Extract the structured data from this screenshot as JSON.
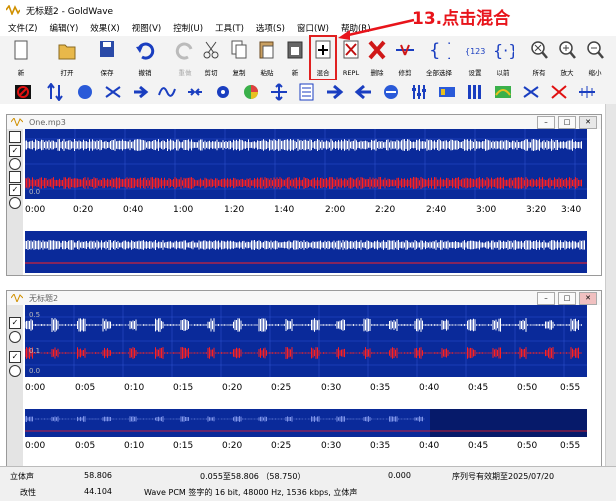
{
  "window": {
    "title": "无标题2 - GoldWave"
  },
  "menu": [
    "文件(Z)",
    "编辑(Y)",
    "效果(X)",
    "视图(V)",
    "控制(U)",
    "工具(T)",
    "选项(S)",
    "窗口(W)",
    "帮助(R)"
  ],
  "toolbar": {
    "new": "新",
    "open": "打开",
    "save": "保存",
    "undo": "撤销",
    "redo": "重做",
    "cut": "剪切",
    "copy": "复制",
    "paste": "粘贴",
    "paste_new": "新",
    "mix": "混合",
    "replace": "REPL",
    "delete": "删除",
    "trim": "修剪",
    "select_all": "全部选择",
    "set": "设置",
    "previous": "以前",
    "all": "所有",
    "zoom_in": "放大",
    "zoom_out": "缩小"
  },
  "annotation": "13.点击混合",
  "windows": [
    {
      "title": "One.mp3",
      "level_label": "0.0",
      "time_ticks": [
        "0:00",
        "0:20",
        "0:40",
        "1:00",
        "1:20",
        "1:40",
        "2:00",
        "2:20",
        "2:40",
        "3:00",
        "3:20",
        "3:40"
      ]
    },
    {
      "title": "无标题2",
      "level_labels": [
        "0.5",
        "0.1",
        "0.0"
      ],
      "time_ticks": [
        "0:00",
        "0:05",
        "0:10",
        "0:15",
        "0:20",
        "0:25",
        "0:30",
        "0:35",
        "0:40",
        "0:45",
        "0:50",
        "0:55"
      ]
    }
  ],
  "status": {
    "channels": "立体声",
    "length": "58.806",
    "selection": "0.055至58.806 （58.750）",
    "position": "0.000",
    "serial_notice": "序列号有效期至2025/07/20",
    "state": "改性",
    "sample_rate_value": "44.104",
    "format": "Wave PCM 签字的 16 bit, 48000 Hz, 1536 kbps, 立体声"
  },
  "colors": {
    "wave_bg": "#0a2a9a",
    "left_channel": "#ffffff",
    "right_channel": "#ff2020",
    "annotation": "#e8141b"
  }
}
